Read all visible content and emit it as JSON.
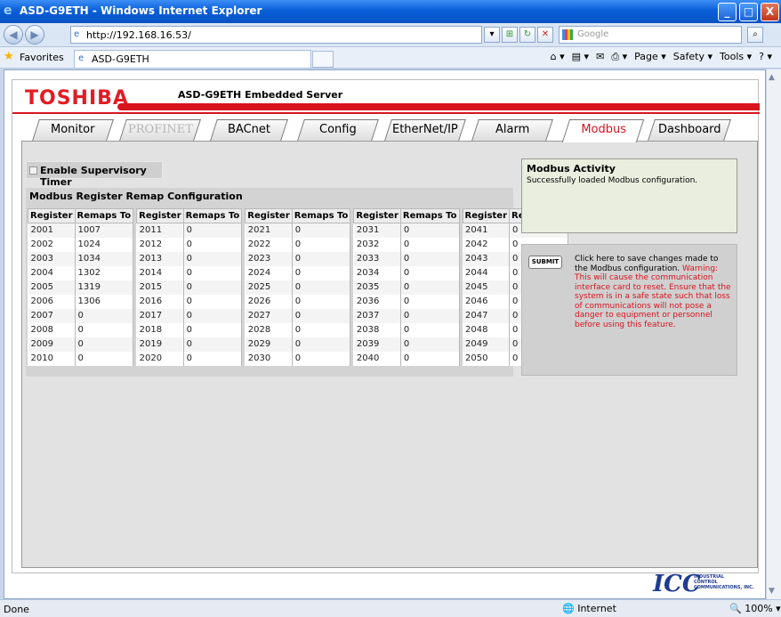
{
  "window": {
    "title": "ASD-G9ETH - Windows Internet Explorer",
    "minimize": "_",
    "maximize": "□",
    "close": "X"
  },
  "address": {
    "url": "http://192.168.16.53/",
    "search_placeholder": "Google"
  },
  "favorites": {
    "label": "Favorites",
    "tab_title": "ASD-G9ETH",
    "commands": [
      "Page ▾",
      "Safety ▾",
      "Tools ▾"
    ]
  },
  "page": {
    "logo": "TOSHIBA",
    "server_title": "ASD-G9ETH Embedded Server",
    "tabs": [
      {
        "label": "Monitor",
        "state": "normal"
      },
      {
        "label": "PROFINET",
        "state": "disabled"
      },
      {
        "label": "BACnet",
        "state": "normal"
      },
      {
        "label": "Config",
        "state": "normal"
      },
      {
        "label": "EtherNet/IP",
        "state": "normal"
      },
      {
        "label": "Alarm",
        "state": "normal"
      },
      {
        "label": "Modbus",
        "state": "active"
      },
      {
        "label": "Dashboard",
        "state": "normal"
      }
    ],
    "supervisory_timer": {
      "label": "Enable Supervisory Timer",
      "checked": false
    },
    "remap": {
      "title": "Modbus Register Remap Configuration",
      "col_register": "Register",
      "col_remaps": "Remaps To",
      "groups": [
        {
          "rows": [
            [
              "2001",
              "1007"
            ],
            [
              "2002",
              "1024"
            ],
            [
              "2003",
              "1034"
            ],
            [
              "2004",
              "1302"
            ],
            [
              "2005",
              "1319"
            ],
            [
              "2006",
              "1306"
            ],
            [
              "2007",
              "0"
            ],
            [
              "2008",
              "0"
            ],
            [
              "2009",
              "0"
            ],
            [
              "2010",
              "0"
            ]
          ]
        },
        {
          "rows": [
            [
              "2011",
              "0"
            ],
            [
              "2012",
              "0"
            ],
            [
              "2013",
              "0"
            ],
            [
              "2014",
              "0"
            ],
            [
              "2015",
              "0"
            ],
            [
              "2016",
              "0"
            ],
            [
              "2017",
              "0"
            ],
            [
              "2018",
              "0"
            ],
            [
              "2019",
              "0"
            ],
            [
              "2020",
              "0"
            ]
          ]
        },
        {
          "rows": [
            [
              "2021",
              "0"
            ],
            [
              "2022",
              "0"
            ],
            [
              "2023",
              "0"
            ],
            [
              "2024",
              "0"
            ],
            [
              "2025",
              "0"
            ],
            [
              "2026",
              "0"
            ],
            [
              "2027",
              "0"
            ],
            [
              "2028",
              "0"
            ],
            [
              "2029",
              "0"
            ],
            [
              "2030",
              "0"
            ]
          ]
        },
        {
          "rows": [
            [
              "2031",
              "0"
            ],
            [
              "2032",
              "0"
            ],
            [
              "2033",
              "0"
            ],
            [
              "2034",
              "0"
            ],
            [
              "2035",
              "0"
            ],
            [
              "2036",
              "0"
            ],
            [
              "2037",
              "0"
            ],
            [
              "2038",
              "0"
            ],
            [
              "2039",
              "0"
            ],
            [
              "2040",
              "0"
            ]
          ]
        },
        {
          "rows": [
            [
              "2041",
              "0"
            ],
            [
              "2042",
              "0"
            ],
            [
              "2043",
              "0"
            ],
            [
              "2044",
              "0"
            ],
            [
              "2045",
              "0"
            ],
            [
              "2046",
              "0"
            ],
            [
              "2047",
              "0"
            ],
            [
              "2048",
              "0"
            ],
            [
              "2049",
              "0"
            ],
            [
              "2050",
              "0"
            ]
          ]
        }
      ]
    },
    "activity": {
      "title": "Modbus Activity",
      "message": "Successfully loaded Modbus configuration."
    },
    "submit": {
      "button": "SUBMIT",
      "description": "Click here to save changes made to the Modbus configuration.",
      "warning": "Warning: This will cause the communication interface card to reset. Ensure that the system is in a safe state such that loss of communications will not pose a danger to equipment or personnel before using this feature."
    },
    "icc_logo": {
      "mark": "ICC",
      "line1": "INDUSTRIAL",
      "line2": "CONTROL",
      "line3": "COMMUNICATIONS, INC."
    }
  },
  "status": {
    "left": "Done",
    "zone": "Internet",
    "zoom": "100%"
  },
  "colors": {
    "brand_red": "#d8141f",
    "activity_bg": "#e9eedf",
    "panel_bg": "#e2e2e2"
  }
}
